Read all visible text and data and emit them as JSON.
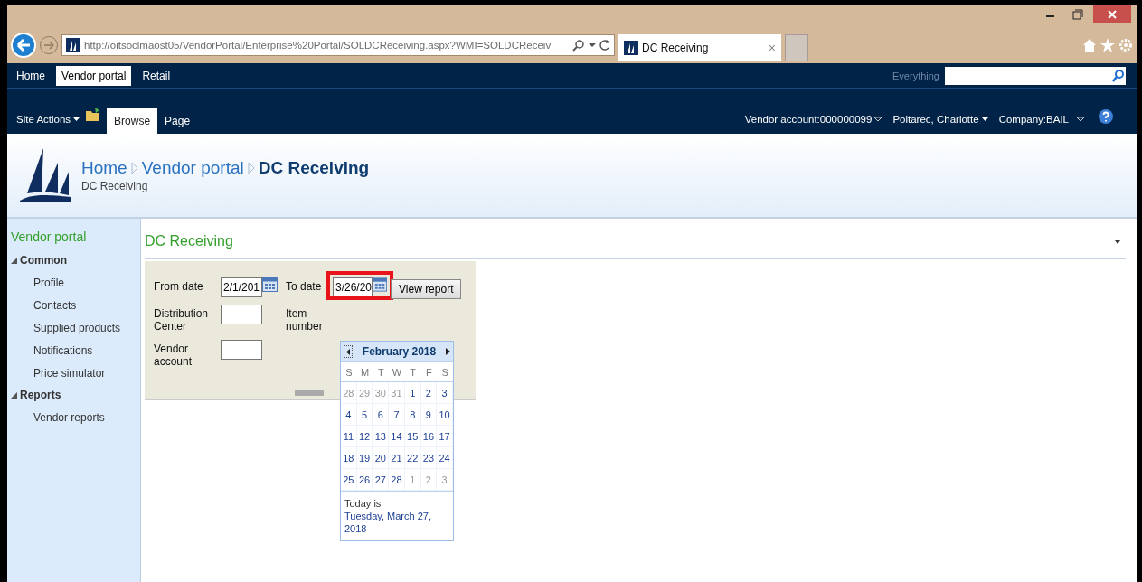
{
  "browser": {
    "url": "http://oitsoclmaost05/VendorPortal/Enterprise%20Portal/SOLDCReceiving.aspx?WMI=SOLDCReceiv",
    "tab_title": "DC Receiving",
    "tab_close": "×"
  },
  "top_nav": {
    "links": [
      {
        "label": "Home",
        "selected": false
      },
      {
        "label": "Vendor portal",
        "selected": true
      },
      {
        "label": "Retail",
        "selected": false
      }
    ],
    "search_scope": "Everything"
  },
  "ribbon": {
    "site_actions": "Site Actions",
    "tabs": [
      {
        "label": "Browse",
        "selected": true
      },
      {
        "label": "Page",
        "selected": false
      }
    ],
    "vendor_account": "Vendor account:000000099",
    "user": "Poltarec, Charlotte",
    "company": "Company:BAIL"
  },
  "header": {
    "breadcrumb": [
      {
        "label": "Home",
        "current": false
      },
      {
        "label": "Vendor portal",
        "current": false
      },
      {
        "label": "DC Receiving",
        "current": true
      }
    ],
    "subtitle": "DC Receiving"
  },
  "quick_launch": {
    "title": "Vendor portal",
    "groups": [
      {
        "label": "Common",
        "expanded": true,
        "children": [
          {
            "label": "Profile"
          },
          {
            "label": "Contacts"
          },
          {
            "label": "Supplied products"
          },
          {
            "label": "Notifications"
          },
          {
            "label": "Price simulator"
          }
        ]
      },
      {
        "label": "Reports",
        "expanded": true,
        "children": [
          {
            "label": "Vendor reports"
          }
        ]
      }
    ]
  },
  "page": {
    "title": "DC Receiving",
    "filters": [
      {
        "label": "From date",
        "kind": "date",
        "value": "2/1/201",
        "highlighted": false
      },
      {
        "label": "To date",
        "kind": "date",
        "value": "3/26/20",
        "highlighted": true
      },
      {
        "label": "Distribution Center",
        "kind": "text",
        "highlighted": false
      },
      {
        "label": "Item number",
        "kind": "label",
        "highlighted": false
      },
      {
        "label": "Vendor account",
        "kind": "text",
        "highlighted": false
      }
    ],
    "view_report": "View report"
  },
  "calendar": {
    "month": "February 2018",
    "weekdays": [
      "S",
      "M",
      "T",
      "W",
      "T",
      "F",
      "S"
    ],
    "weeks": [
      [
        {
          "day": "28",
          "muted": true
        },
        {
          "day": "29",
          "muted": true
        },
        {
          "day": "30",
          "muted": true
        },
        {
          "day": "31",
          "muted": true
        },
        {
          "day": "1",
          "muted": false
        },
        {
          "day": "2",
          "muted": false
        },
        {
          "day": "3",
          "muted": false
        }
      ],
      [
        {
          "day": "4",
          "muted": false
        },
        {
          "day": "5",
          "muted": false
        },
        {
          "day": "6",
          "muted": false
        },
        {
          "day": "7",
          "muted": false
        },
        {
          "day": "8",
          "muted": false
        },
        {
          "day": "9",
          "muted": false
        },
        {
          "day": "10",
          "muted": false
        }
      ],
      [
        {
          "day": "11",
          "muted": false
        },
        {
          "day": "12",
          "muted": false
        },
        {
          "day": "13",
          "muted": false
        },
        {
          "day": "14",
          "muted": false
        },
        {
          "day": "15",
          "muted": false
        },
        {
          "day": "16",
          "muted": false
        },
        {
          "day": "17",
          "muted": false
        }
      ],
      [
        {
          "day": "18",
          "muted": false
        },
        {
          "day": "19",
          "muted": false
        },
        {
          "day": "20",
          "muted": false
        },
        {
          "day": "21",
          "muted": false
        },
        {
          "day": "22",
          "muted": false
        },
        {
          "day": "23",
          "muted": false
        },
        {
          "day": "24",
          "muted": false
        }
      ],
      [
        {
          "day": "25",
          "muted": false
        },
        {
          "day": "26",
          "muted": false
        },
        {
          "day": "27",
          "muted": false
        },
        {
          "day": "28",
          "muted": false
        },
        {
          "day": "1",
          "muted": true
        },
        {
          "day": "2",
          "muted": true
        },
        {
          "day": "3",
          "muted": true
        }
      ]
    ],
    "today_prefix": "Today is",
    "today_link": "Tuesday, March 27, 2018"
  }
}
